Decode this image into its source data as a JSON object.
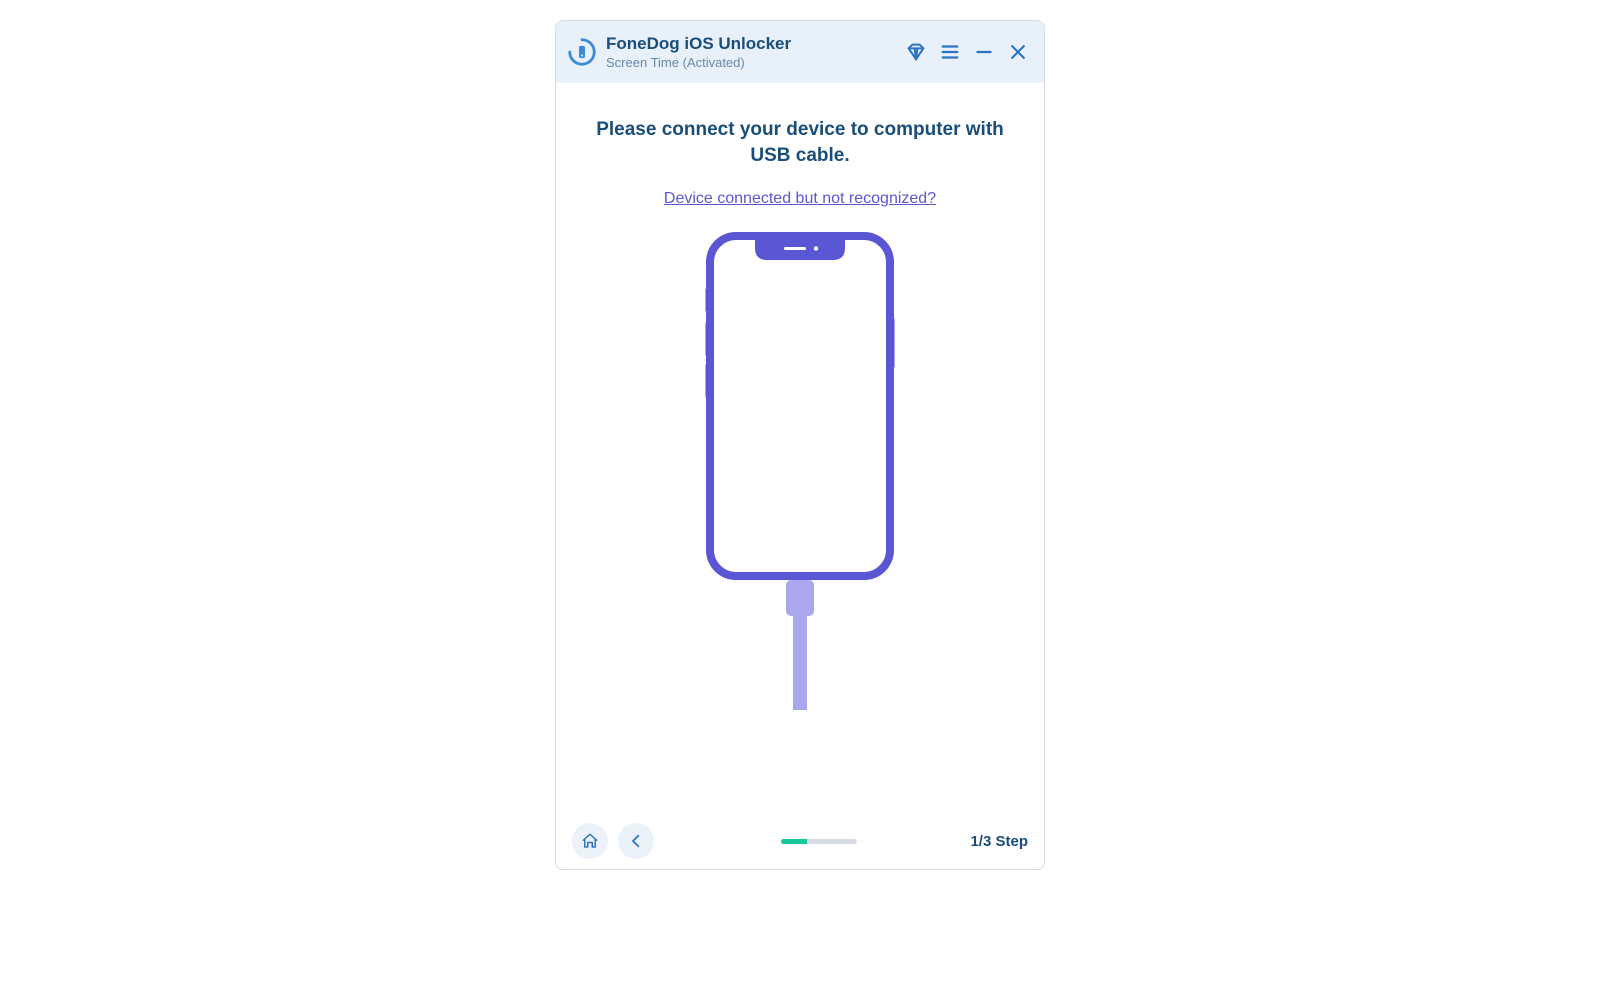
{
  "header": {
    "title": "FoneDog iOS Unlocker",
    "subtitle": "Screen Time  (Activated)"
  },
  "main": {
    "instruction": "Please connect your device to computer with USB cable.",
    "help_link": "Device connected but not recognized?"
  },
  "footer": {
    "step_label": "1/3 Step",
    "progress_percent": 33.3
  },
  "colors": {
    "accent": "#2b74c2",
    "text_primary": "#1a4d7a",
    "link": "#5a56d4",
    "progress": "#19c69b",
    "phone_outline": "#5a56d4",
    "phone_light": "#a9a7ed"
  },
  "icons": {
    "logo": "app-logo",
    "diamond": "diamond-icon",
    "menu": "menu-icon",
    "minimize": "minimize-icon",
    "close": "close-icon",
    "home": "home-icon",
    "back": "chevron-left-icon"
  }
}
